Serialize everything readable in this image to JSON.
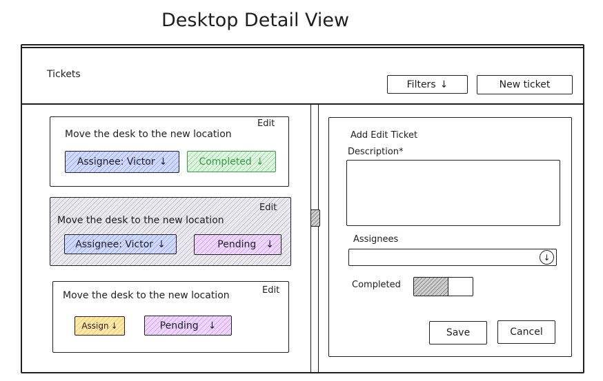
{
  "page_title": "Desktop Detail View",
  "header": {
    "title": "Tickets",
    "filters_label": "Filters",
    "new_ticket_label": "New ticket"
  },
  "tickets": [
    {
      "description": "Move the desk to the new location",
      "edit": "Edit",
      "assignee": "Assignee: Victor",
      "status": "Completed"
    },
    {
      "description": "Move the desk to the new location",
      "edit": "Edit",
      "assignee": "Assignee: Victor",
      "status": "Pending"
    },
    {
      "description": "Move the desk to the new location",
      "edit": "Edit",
      "assignee": "Assign",
      "status": "Pending"
    }
  ],
  "form": {
    "title": "Add Edit Ticket",
    "description_label": "Description*",
    "description_value": "",
    "assignees_label": "Assignees",
    "assignees_value": "",
    "completed_label": "Completed",
    "completed_toggle": "off",
    "save_label": "Save",
    "cancel_label": "Cancel"
  },
  "icons": {
    "dropdown": "arrow-down-icon",
    "select": "circle-arrow-down-icon"
  },
  "colors": {
    "assignee_fill": "#d0d9ff",
    "completed_fill": "#dff5df",
    "completed_stroke": "#2f9e44",
    "pending_fill": "#eed6ff",
    "assign_fill": "#ffe9a8",
    "selected_card_fill": "#e9e9ee"
  }
}
